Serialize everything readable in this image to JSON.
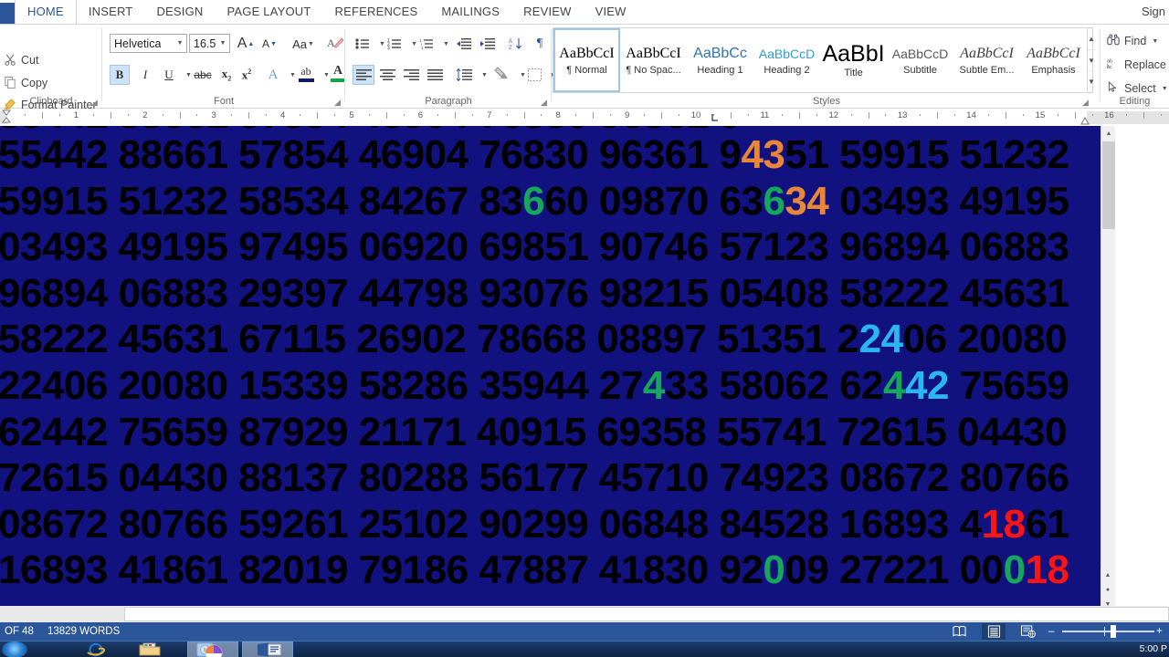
{
  "app": {
    "signin_label": "Sign"
  },
  "tabs": [
    {
      "label": "HOME",
      "active": true
    },
    {
      "label": "INSERT",
      "active": false
    },
    {
      "label": "DESIGN",
      "active": false
    },
    {
      "label": "PAGE LAYOUT",
      "active": false
    },
    {
      "label": "REFERENCES",
      "active": false
    },
    {
      "label": "MAILINGS",
      "active": false
    },
    {
      "label": "REVIEW",
      "active": false
    },
    {
      "label": "VIEW",
      "active": false
    }
  ],
  "ribbon": {
    "clipboard": {
      "group_label": "Clipboard",
      "items": [
        {
          "label": "Cut",
          "icon": "scissors-icon"
        },
        {
          "label": "Copy",
          "icon": "copy-icon"
        },
        {
          "label": "Format Painter",
          "icon": "paintbrush-icon"
        }
      ]
    },
    "font": {
      "group_label": "Font",
      "font_name": "Helvetica",
      "font_size": "16.5",
      "buttons": [
        {
          "name": "grow-font",
          "label": "A"
        },
        {
          "name": "shrink-font",
          "label": "A"
        },
        {
          "name": "change-case",
          "label": "Aa"
        },
        {
          "name": "clear-formatting",
          "label": "clear"
        },
        {
          "name": "bold",
          "label": "B",
          "active": true
        },
        {
          "name": "italic",
          "label": "I"
        },
        {
          "name": "underline",
          "label": "U"
        },
        {
          "name": "strikethrough",
          "label": "abc"
        },
        {
          "name": "subscript",
          "label": "x"
        },
        {
          "name": "superscript",
          "label": "x"
        },
        {
          "name": "text-effects",
          "label": "A"
        },
        {
          "name": "text-highlight-color",
          "label": "ab"
        },
        {
          "name": "font-color",
          "label": "A"
        }
      ]
    },
    "paragraph": {
      "group_label": "Paragraph",
      "buttons": [
        {
          "name": "bullets"
        },
        {
          "name": "numbering"
        },
        {
          "name": "multilevel-list"
        },
        {
          "name": "decrease-indent"
        },
        {
          "name": "increase-indent"
        },
        {
          "name": "sort"
        },
        {
          "name": "show-formatting-marks",
          "label": "¶"
        },
        {
          "name": "align-left",
          "active": true
        },
        {
          "name": "align-center"
        },
        {
          "name": "align-right"
        },
        {
          "name": "justify"
        },
        {
          "name": "line-spacing"
        },
        {
          "name": "shading"
        },
        {
          "name": "borders"
        }
      ]
    },
    "styles": {
      "group_label": "Styles",
      "items": [
        {
          "preview": "AaBbCcI",
          "name": "¶ Normal",
          "selected": true,
          "color": "#000000",
          "serif": true
        },
        {
          "preview": "AaBbCcI",
          "name": "¶ No Spac...",
          "selected": false,
          "color": "#000000",
          "serif": true
        },
        {
          "preview": "AaBbCc",
          "name": "Heading 1",
          "selected": false,
          "color": "#2e74b5",
          "serif": false
        },
        {
          "preview": "AaBbCcD",
          "name": "Heading 2",
          "selected": false,
          "color": "#2e9fd5",
          "serif": false
        },
        {
          "preview": "AaBbI",
          "name": "Title",
          "selected": false,
          "color": "#000000",
          "serif": false
        },
        {
          "preview": "AaBbCcD",
          "name": "Subtitle",
          "selected": false,
          "color": "#5a5a5a",
          "serif": false
        },
        {
          "preview": "AaBbCcI",
          "name": "Subtle Em...",
          "selected": false,
          "color": "#404040",
          "serif": true
        },
        {
          "preview": "AaBbCcI",
          "name": "Emphasis",
          "selected": false,
          "color": "#404040",
          "serif": true
        }
      ]
    },
    "editing": {
      "group_label": "Editing",
      "items": [
        {
          "label": "Find",
          "icon": "binoculars-icon",
          "has_arrow": true
        },
        {
          "label": "Replace",
          "icon": "replace-icon",
          "has_arrow": false
        },
        {
          "label": "Select",
          "icon": "cursor-select-icon",
          "has_arrow": true
        }
      ]
    }
  },
  "ruler": {
    "ticks": [
      "1",
      "2",
      "3",
      "4",
      "5",
      "6",
      "7",
      "8",
      "9",
      "10",
      "11",
      "12",
      "13",
      "14",
      "15",
      "16"
    ]
  },
  "document": {
    "background_color": "#11117f",
    "text_color": "#000000",
    "lines": [
      {
        "segments": [
          {
            "text": "55442 88661 57854 46904 76830 96361 9",
            "color": "#000000"
          },
          {
            "text": "43",
            "color": "#e8873a"
          },
          {
            "text": "51 59915 51232",
            "color": "#000000"
          }
        ]
      },
      {
        "segments": [
          {
            "text": "59915 51232 58534 84267 83",
            "color": "#000000"
          },
          {
            "text": "6",
            "color": "#16a85a"
          },
          {
            "text": "60 09870 63",
            "color": "#000000"
          },
          {
            "text": "6",
            "color": "#16a85a"
          },
          {
            "text": "34",
            "color": "#e8873a"
          },
          {
            "text": " 03493 49195",
            "color": "#000000"
          }
        ]
      },
      {
        "segments": [
          {
            "text": "03493 49195 97495 06920 69851 90746 57123 96894 06883",
            "color": "#000000"
          }
        ]
      },
      {
        "segments": [
          {
            "text": "96894 06883 29397 44798 93076 98215 05408 58222 45631",
            "color": "#000000"
          }
        ]
      },
      {
        "segments": [
          {
            "text": "58222 45631 67115 26902 78668 08897 51351 2",
            "color": "#000000"
          },
          {
            "text": "24",
            "color": "#2ab6f0"
          },
          {
            "text": "06 20080",
            "color": "#000000"
          }
        ]
      },
      {
        "segments": [
          {
            "text": "22406 20080 15339 58286 35944 27",
            "color": "#000000"
          },
          {
            "text": "4",
            "color": "#16a85a"
          },
          {
            "text": "33 58062 62",
            "color": "#000000"
          },
          {
            "text": "4",
            "color": "#16a85a"
          },
          {
            "text": "42",
            "color": "#2ab6f0"
          },
          {
            "text": " 75659",
            "color": "#000000"
          }
        ]
      },
      {
        "segments": [
          {
            "text": "62442 75659 87929 21171 40915 69358 55741 72615 04430",
            "color": "#000000"
          }
        ]
      },
      {
        "segments": [
          {
            "text": "72615 04430 88137 80288 56177 45710 74923 08672 80766",
            "color": "#000000"
          }
        ]
      },
      {
        "segments": [
          {
            "text": "08672 80766 59261 25102 90299 06848 84528 16893 4",
            "color": "#000000"
          },
          {
            "text": "18",
            "color": "#fa1414"
          },
          {
            "text": "61",
            "color": "#000000"
          }
        ]
      },
      {
        "segments": [
          {
            "text": "16893 41861 82019 79186 47887 41830 92",
            "color": "#000000"
          },
          {
            "text": "0",
            "color": "#16a85a"
          },
          {
            "text": "09 27221 00",
            "color": "#000000"
          },
          {
            "text": "0",
            "color": "#16a85a"
          },
          {
            "text": "18",
            "color": "#fa1414"
          }
        ]
      }
    ]
  },
  "statusbar": {
    "page_text": "OF 48",
    "word_count": "13829 WORDS",
    "views": [
      {
        "name": "read-mode-view",
        "selected": false
      },
      {
        "name": "print-layout-view",
        "selected": true
      },
      {
        "name": "web-layout-view",
        "selected": false
      }
    ],
    "zoom_out": "–",
    "zoom_in": "+"
  },
  "taskbar": {
    "clock": "5:00 P",
    "icons": [
      {
        "name": "start-orb"
      },
      {
        "name": "internet-explorer-icon"
      },
      {
        "name": "file-explorer-icon"
      },
      {
        "name": "media-player-icon"
      },
      {
        "name": "taskbar-window-browser"
      },
      {
        "name": "taskbar-window-word"
      }
    ]
  }
}
